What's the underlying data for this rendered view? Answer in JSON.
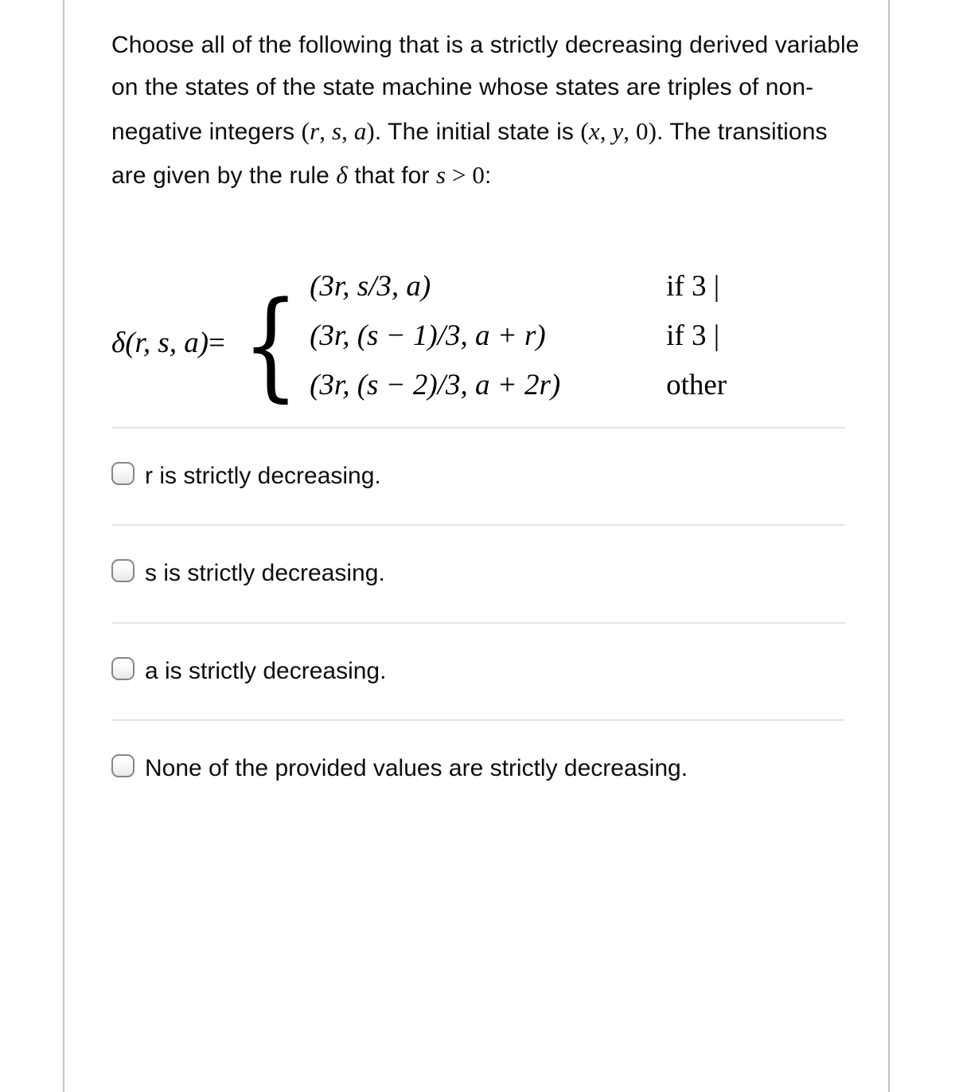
{
  "question": {
    "stem_segments": [
      {
        "t": "Choose all of the following that is a strictly decreasing derived variable on the states of the state machine whose states are triples of non-negative integers ",
        "k": "text"
      },
      {
        "t": "(",
        "k": "op"
      },
      {
        "t": "r",
        "k": "var"
      },
      {
        "t": ", ",
        "k": "op"
      },
      {
        "t": "s",
        "k": "var"
      },
      {
        "t": ", ",
        "k": "op"
      },
      {
        "t": "a",
        "k": "var"
      },
      {
        "t": ")",
        "k": "op"
      },
      {
        "t": ". The initial state is ",
        "k": "text"
      },
      {
        "t": "(",
        "k": "op"
      },
      {
        "t": "x",
        "k": "var"
      },
      {
        "t": ", ",
        "k": "op"
      },
      {
        "t": "y",
        "k": "var"
      },
      {
        "t": ", ",
        "k": "op"
      },
      {
        "t": "0",
        "k": "num"
      },
      {
        "t": ")",
        "k": "op"
      },
      {
        "t": ". The transitions are given by the rule ",
        "k": "text"
      },
      {
        "t": "δ",
        "k": "var"
      },
      {
        "t": " that for ",
        "k": "text"
      },
      {
        "t": "s",
        "k": "var"
      },
      {
        "t": " > ",
        "k": "op"
      },
      {
        "t": "0",
        "k": "num"
      },
      {
        "t": ":",
        "k": "text"
      }
    ],
    "stem_plain": "Choose all of the following that is a strictly decreasing derived variable on the states of the state machine whose states are triples of non-negative integers (r, s, a). The initial state is (x, y, 0). The transitions are given by the rule δ that for s > 0:"
  },
  "formula": {
    "lhs": "δ(r, s, a)",
    "equals": "=",
    "brace": "{",
    "cases": [
      {
        "expression": "(3r, s/3, a)",
        "condition": "if 3 |"
      },
      {
        "expression": "(3r, (s − 1)/3, a + r)",
        "condition": "if 3 |"
      },
      {
        "expression": "(3r, (s − 2)/3, a + 2r)",
        "condition": "other"
      }
    ]
  },
  "options": [
    {
      "label": "r is strictly decreasing.",
      "selected": false
    },
    {
      "label": "s is strictly decreasing.",
      "selected": false
    },
    {
      "label": "a is strictly decreasing.",
      "selected": false
    },
    {
      "label": "None of the provided values are strictly decreasing.",
      "selected": false
    }
  ],
  "colors": {
    "text": "#0d0d0d",
    "divider": "#e3e4e6",
    "frame_border": "#c3c3c3",
    "radio_border": "#84868a",
    "background": "#ffffff"
  }
}
